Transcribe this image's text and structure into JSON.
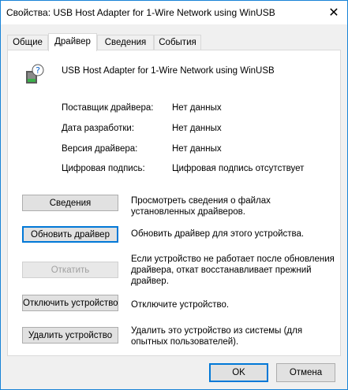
{
  "window": {
    "title": "Свойства: USB Host Adapter for 1-Wire Network using WinUSB",
    "close_glyph": "✕"
  },
  "tabs": [
    {
      "label": "Общие"
    },
    {
      "label": "Драйвер"
    },
    {
      "label": "Сведения"
    },
    {
      "label": "События"
    }
  ],
  "device": {
    "name": "USB Host Adapter for 1-Wire Network using WinUSB",
    "icon": "usb-device-unknown-icon"
  },
  "properties": [
    {
      "label": "Поставщик драйвера:",
      "value": "Нет данных"
    },
    {
      "label": "Дата разработки:",
      "value": "Нет данных"
    },
    {
      "label": "Версия драйвера:",
      "value": "Нет данных"
    },
    {
      "label": "Цифровая подпись:",
      "value": "Цифровая подпись отсутствует"
    }
  ],
  "actions": [
    {
      "label": "Сведения",
      "description": "Просмотреть сведения о файлах установленных драйверов."
    },
    {
      "label": "Обновить драйвер",
      "description": "Обновить драйвер для этого устройства."
    },
    {
      "label": "Откатить",
      "description": "Если устройство не работает после обновления драйвера, откат восстанавливает прежний драйвер."
    },
    {
      "label": "Отключить устройство",
      "description": "Отключите устройство."
    },
    {
      "label": "Удалить устройство",
      "description": "Удалить это устройство из системы (для опытных пользователей)."
    }
  ],
  "footer": {
    "ok_label": "OK",
    "cancel_label": "Отмена"
  },
  "colors": {
    "accent": "#0078d7",
    "window_border": "#1883d7"
  }
}
